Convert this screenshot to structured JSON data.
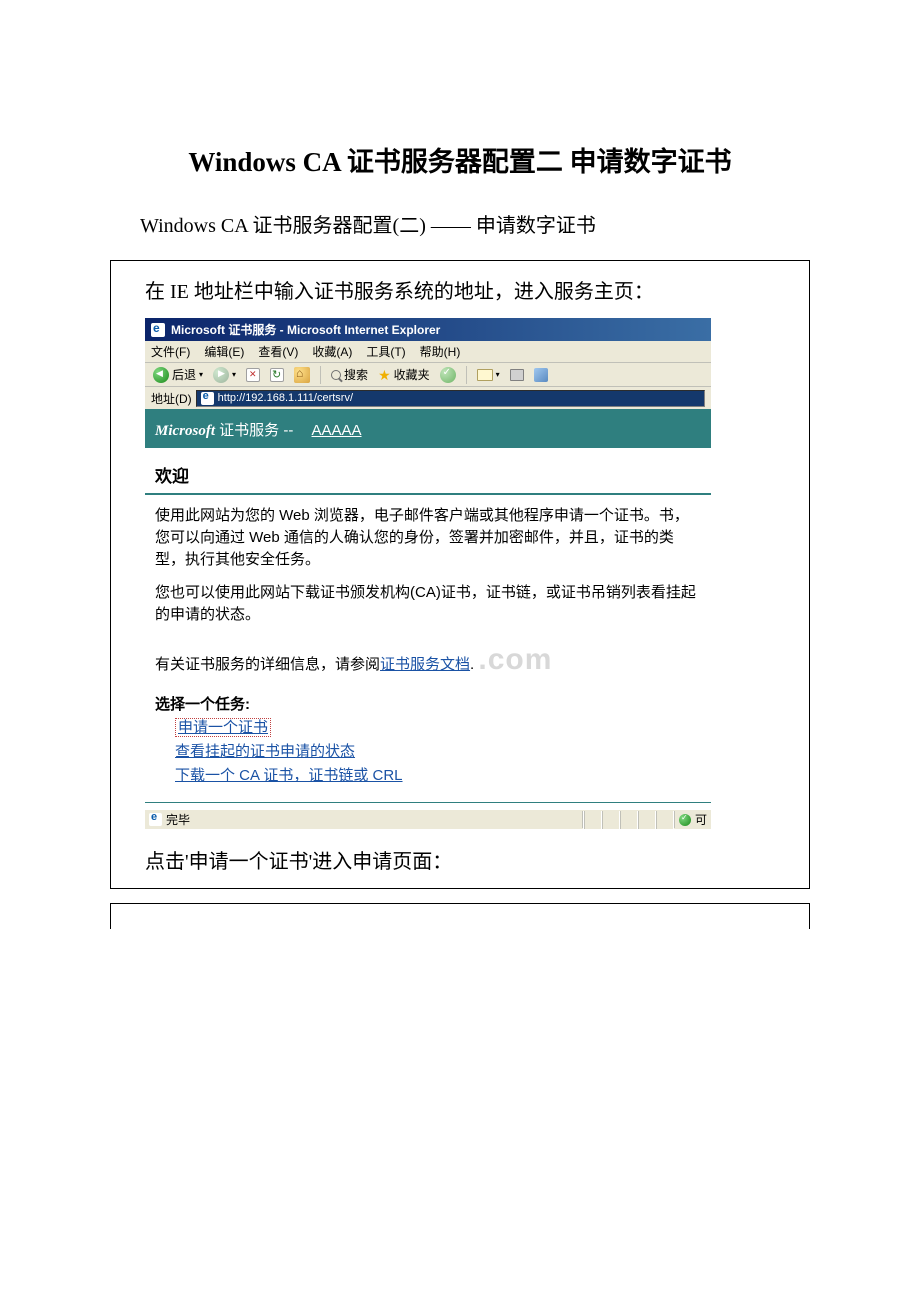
{
  "doc": {
    "title": "Windows CA 证书服务器配置二 申请数字证书",
    "subtitle": "Windows CA 证书服务器配置(二) —— 申请数字证书",
    "intro_note": "在 IE 地址栏中输入证书服务系统的地址，进入服务主页：",
    "after_note": "点击'申请一个证书'进入申请页面："
  },
  "ie": {
    "window_title": "Microsoft 证书服务 - Microsoft Internet Explorer",
    "menu": {
      "file": "文件(F)",
      "edit": "编辑(E)",
      "view": "查看(V)",
      "fav": "收藏(A)",
      "tools": "工具(T)",
      "help": "帮助(H)"
    },
    "toolbar": {
      "back": "后退",
      "search": "搜索",
      "fav": "收藏夹"
    },
    "address_label": "地址(D)",
    "url": "http://192.168.1.111/certsrv/"
  },
  "certsrv": {
    "header_ms": "Microsoft",
    "header_text": " 证书服务 -- ",
    "header_ca": "AAAAA",
    "welcome": "欢迎",
    "para1": "使用此网站为您的 Web 浏览器，电子邮件客户端或其他程序申请一个证书。书，您可以向通过 Web 通信的人确认您的身份，签署并加密邮件，并且，证书的类型，执行其他安全任务。",
    "para2": "您也可以使用此网站下载证书颁发机构(CA)证书，证书链，或证书吊销列表看挂起的申请的状态。",
    "para3_prefix": "有关证书服务的详细信息，请参阅",
    "para3_link": "证书服务文档",
    "watermark": ".com",
    "tasks_title": "选择一个任务:",
    "task1": "申请一个证书",
    "task2": "查看挂起的证书申请的状态",
    "task3": "下载一个 CA 证书，证书链或 CRL"
  },
  "status": {
    "done": "完毕",
    "zone": "可"
  }
}
